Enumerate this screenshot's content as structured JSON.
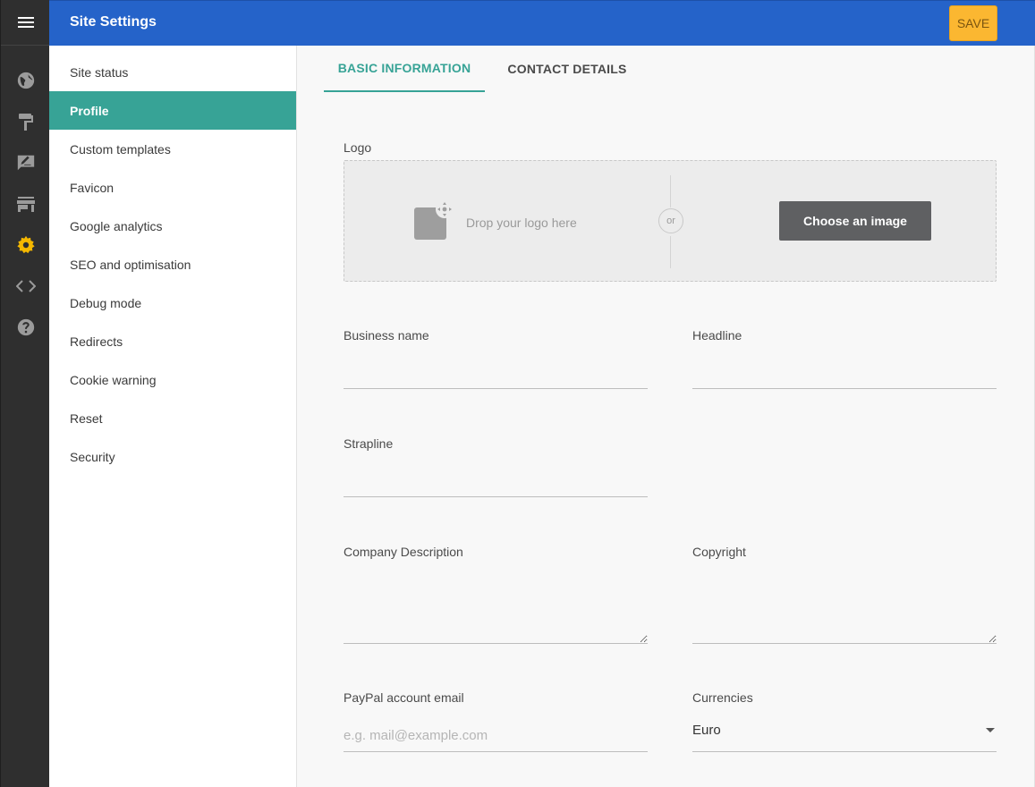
{
  "header": {
    "title": "Site Settings",
    "save_label": "SAVE"
  },
  "rail": {
    "icons": [
      "menu-icon",
      "globe-icon",
      "paint-roller-icon",
      "edit-icon",
      "store-icon",
      "gear-icon",
      "code-icon",
      "help-icon"
    ],
    "active": "gear-icon",
    "active_color": "#f5b800"
  },
  "menu": {
    "items": [
      {
        "label": "Site status"
      },
      {
        "label": "Profile"
      },
      {
        "label": "Custom templates"
      },
      {
        "label": "Favicon"
      },
      {
        "label": "Google analytics"
      },
      {
        "label": "SEO and optimisation"
      },
      {
        "label": "Debug mode"
      },
      {
        "label": "Redirects"
      },
      {
        "label": "Cookie warning"
      },
      {
        "label": "Reset"
      },
      {
        "label": "Security"
      }
    ],
    "active_item": "Profile"
  },
  "tabs": {
    "basic": "BASIC INFORMATION",
    "contact": "CONTACT DETAILS",
    "active": "BASIC INFORMATION"
  },
  "logo": {
    "label": "Logo",
    "drop_text": "Drop your logo here",
    "or_text": "or",
    "choose_label": "Choose an image"
  },
  "fields": {
    "business_name": {
      "label": "Business name",
      "value": ""
    },
    "headline": {
      "label": "Headline",
      "value": ""
    },
    "strapline": {
      "label": "Strapline",
      "value": ""
    },
    "company_description": {
      "label": "Company Description",
      "value": ""
    },
    "copyright": {
      "label": "Copyright",
      "value": ""
    },
    "paypal_email": {
      "label": "PayPal account email",
      "placeholder": "e.g. mail@example.com",
      "value": ""
    },
    "currencies": {
      "label": "Currencies",
      "value": "Euro"
    }
  },
  "colors": {
    "header": "#2563c9",
    "accent": "#37a396",
    "save": "#fbb731",
    "rail": "#2f2f2f"
  }
}
